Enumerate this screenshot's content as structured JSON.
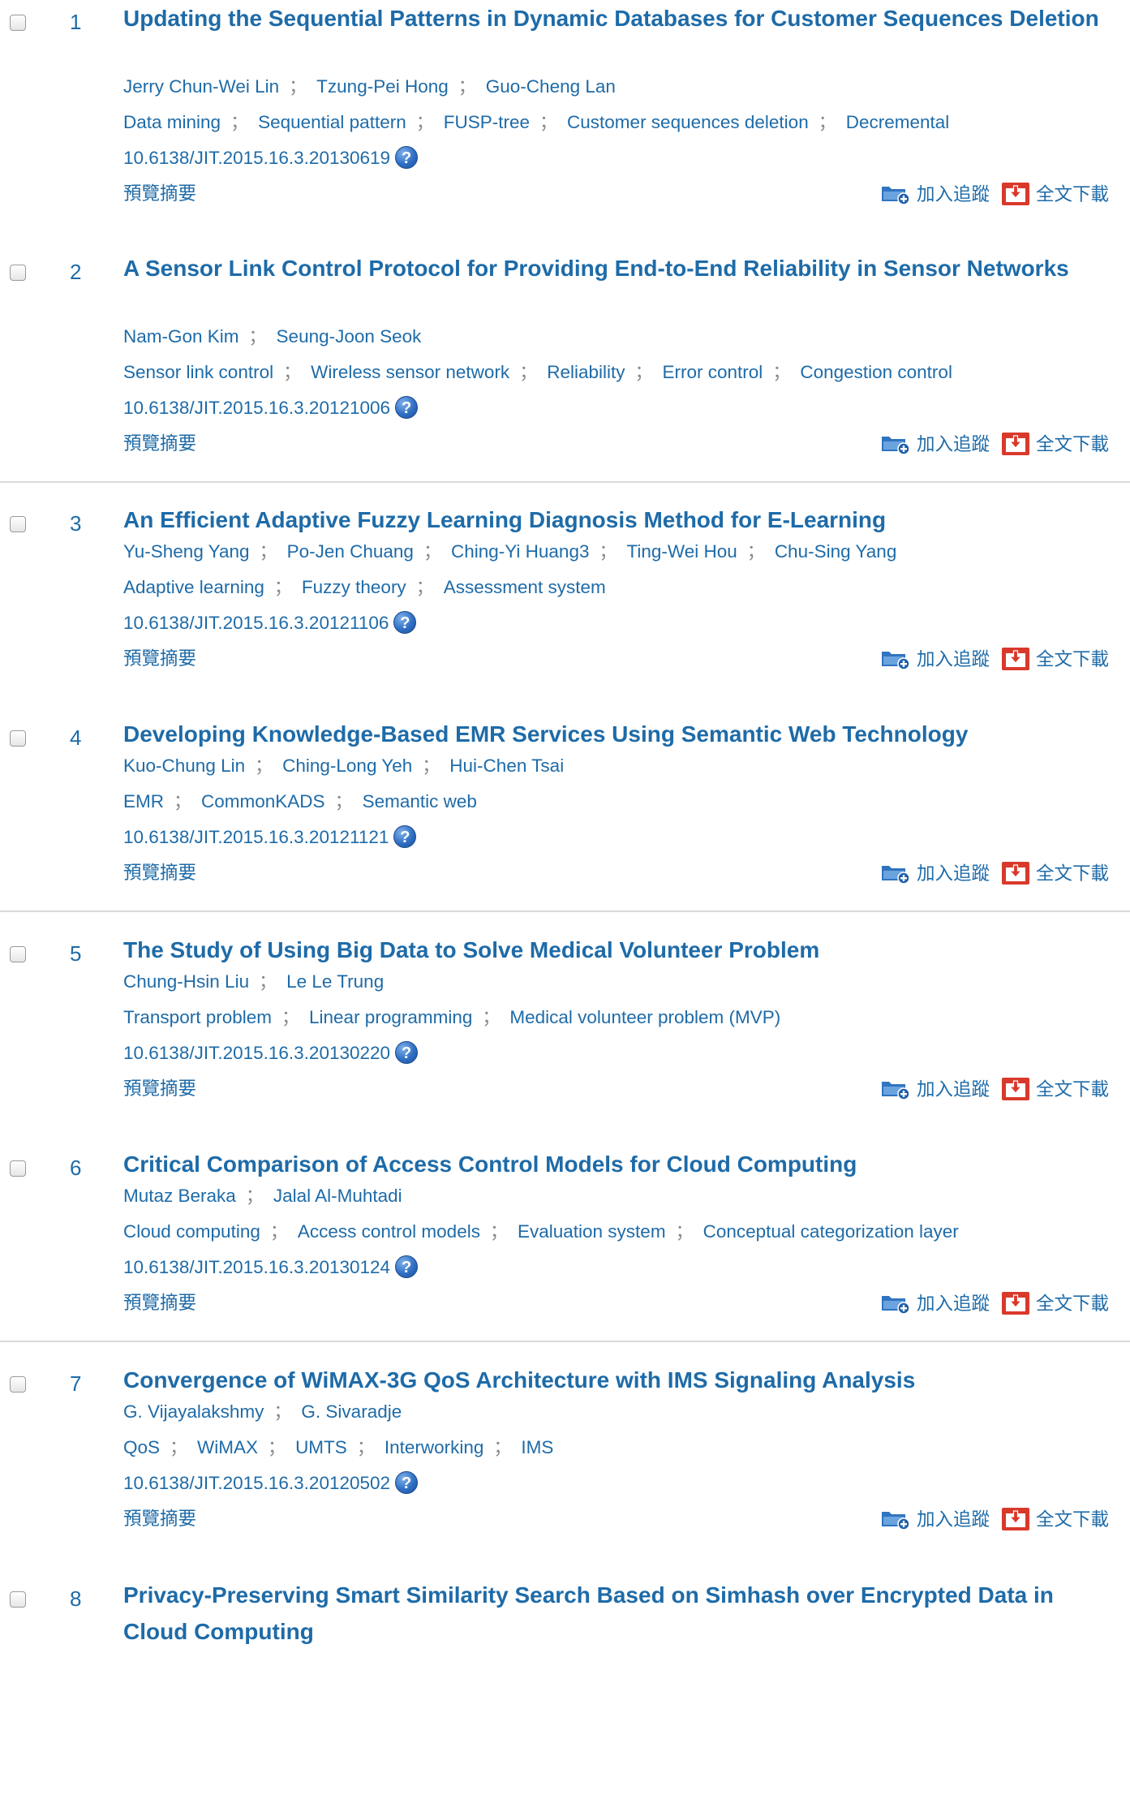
{
  "separator": "；",
  "doi_help_glyph": "?",
  "abstract_label": "預覽摘要",
  "track_label": "加入追蹤",
  "download_label": "全文下載",
  "icons": {
    "track": "add-to-folder-icon",
    "download": "download-icon",
    "doi_help": "help-icon"
  },
  "colors": {
    "link": "#1e6ba8",
    "separator_line": "#d9d9d9",
    "download_icon": "#d9392b"
  },
  "articles": [
    {
      "number": "1",
      "title": "Updating the Sequential Patterns in Dynamic Databases for Customer Sequences Deletion",
      "authors": [
        "Jerry Chun-Wei Lin",
        "Tzung-Pei Hong",
        "Guo-Cheng Lan"
      ],
      "keywords": [
        "Data mining",
        "Sequential pattern",
        "FUSP-tree",
        "Customer sequences deletion",
        "Decremental"
      ],
      "doi": "10.6138/JIT.2015.16.3.20130619"
    },
    {
      "number": "2",
      "title": "A Sensor Link Control Protocol for Providing End-to-End Reliability in Sensor Networks",
      "authors": [
        "Nam-Gon Kim",
        "Seung-Joon Seok"
      ],
      "keywords": [
        "Sensor link control",
        "Wireless sensor network",
        "Reliability",
        "Error control",
        "Congestion control"
      ],
      "doi": "10.6138/JIT.2015.16.3.20121006"
    },
    {
      "number": "3",
      "title": "An Efficient Adaptive Fuzzy Learning Diagnosis Method for E-Learning",
      "authors": [
        "Yu-Sheng Yang",
        "Po-Jen Chuang",
        "Ching-Yi Huang3",
        "Ting-Wei Hou",
        "Chu-Sing Yang"
      ],
      "keywords": [
        "Adaptive learning",
        "Fuzzy theory",
        "Assessment system"
      ],
      "doi": "10.6138/JIT.2015.16.3.20121106"
    },
    {
      "number": "4",
      "title": "Developing Knowledge-Based EMR Services Using Semantic Web Technology",
      "authors": [
        "Kuo-Chung Lin",
        "Ching-Long Yeh",
        "Hui-Chen Tsai"
      ],
      "keywords": [
        "EMR",
        "CommonKADS",
        "Semantic web"
      ],
      "doi": "10.6138/JIT.2015.16.3.20121121"
    },
    {
      "number": "5",
      "title": "The Study of Using Big Data to Solve Medical Volunteer Problem",
      "authors": [
        "Chung-Hsin Liu",
        "Le Le Trung"
      ],
      "keywords": [
        "Transport problem",
        "Linear programming",
        "Medical volunteer problem (MVP)"
      ],
      "doi": "10.6138/JIT.2015.16.3.20130220"
    },
    {
      "number": "6",
      "title": "Critical Comparison of Access Control Models for Cloud Computing",
      "authors": [
        "Mutaz Beraka",
        "Jalal Al-Muhtadi"
      ],
      "keywords": [
        "Cloud computing",
        "Access control models",
        "Evaluation system",
        "Conceptual categorization layer"
      ],
      "doi": "10.6138/JIT.2015.16.3.20130124"
    },
    {
      "number": "7",
      "title": "Convergence of WiMAX-3G QoS Architecture with IMS Signaling Analysis",
      "authors": [
        "G. Vijayalakshmy",
        "G. Sivaradje"
      ],
      "keywords": [
        "QoS",
        "WiMAX",
        "UMTS",
        "Interworking",
        "IMS"
      ],
      "doi": "10.6138/JIT.2015.16.3.20120502"
    },
    {
      "number": "8",
      "title": "Privacy-Preserving Smart Similarity Search Based on Simhash over Encrypted Data in Cloud Computing"
    }
  ]
}
